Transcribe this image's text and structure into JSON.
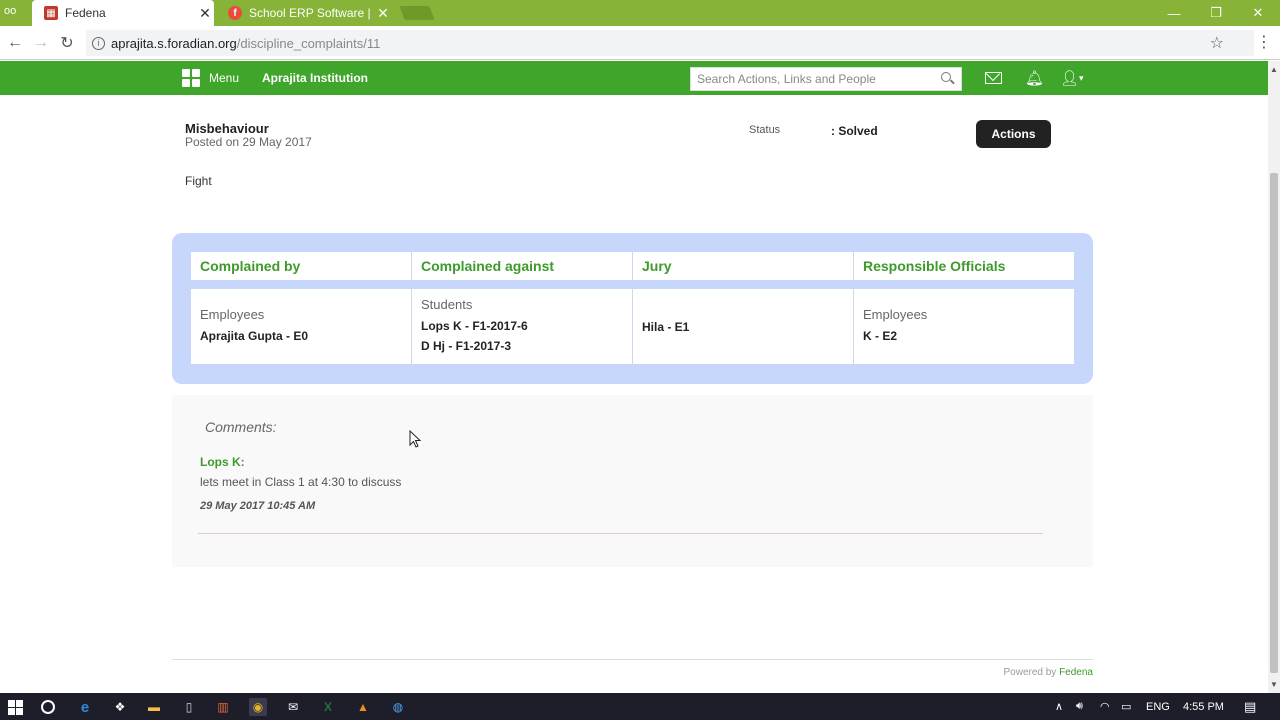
{
  "browser": {
    "tabs": [
      {
        "title": "Fedena",
        "active": true
      },
      {
        "title": "School ERP Software | Sc",
        "active": false
      }
    ],
    "url_host": "aprajita.s.foradian.org",
    "url_path": "/discipline_complaints/11"
  },
  "appbar": {
    "menu_label": "Menu",
    "institution": "Aprajita Institution",
    "search_placeholder": "Search Actions, Links and People"
  },
  "complaint": {
    "title": "Misbehaviour",
    "posted": "Posted on 29 May 2017",
    "status_label": "Status",
    "status_value": ": Solved",
    "actions_label": "Actions",
    "description": "Fight"
  },
  "parties": {
    "headers": [
      "Complained by",
      "Complained against",
      "Jury",
      "Responsible Officials"
    ],
    "complained_by": {
      "category": "Employees",
      "names": [
        "Aprajita Gupta - E0"
      ]
    },
    "complained_against": {
      "category": "Students",
      "names": [
        "Lops K - F1-2017-6",
        "D Hj - F1-2017-3"
      ]
    },
    "jury": {
      "category": "",
      "names": [
        "Hila - E1"
      ]
    },
    "responsible": {
      "category": "Employees",
      "names": [
        "K - E2"
      ]
    }
  },
  "comments": {
    "heading": "Comments:",
    "items": [
      {
        "author": "Lops K:",
        "text": "lets meet in Class 1 at 4:30 to discuss",
        "time": "29 May 2017 10:45 AM"
      }
    ]
  },
  "footer": {
    "powered_prefix": "Powered by ",
    "powered_brand": "Fedena"
  },
  "taskbar": {
    "language": "ENG",
    "clock": "4:55 PM"
  },
  "colors": {
    "brand_green": "#3fa52b",
    "panel_blue": "#c7d6fb",
    "chrome_green": "#86b338"
  }
}
